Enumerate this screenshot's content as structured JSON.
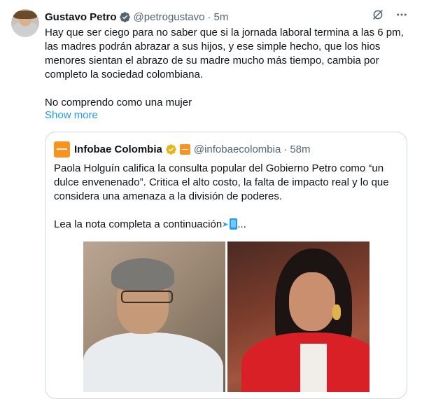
{
  "tweet": {
    "author_name": "Gustavo Petro",
    "handle": "@petrogustavo",
    "separator": "·",
    "time": "5m",
    "body_paragraph_1": "Hay que ser ciego para no saber que si la jornada laboral termina a las 6 pm, las madres podrán abrazar a sus hijos, y ese simple hecho, que los hios menores sientan el abrazo de su madre mucho más tiempo, cambia por completo la sociedad colombiana.",
    "body_paragraph_2": "No comprendo como una mujer",
    "show_more": "Show more"
  },
  "icons": {
    "verified": "verified-badge-icon",
    "grok": "grok-icon",
    "more": "more-options-icon",
    "gold_verified": "gold-verified-badge-icon",
    "org_affiliation": "org-affiliation-badge-icon",
    "phone_emoji": "mobile-phone-with-arrow-emoji"
  },
  "quote": {
    "author_name": "Infobae Colombia",
    "handle": "@infobaecolombia",
    "separator": "·",
    "time": "58m",
    "body_paragraph_1": "Paola Holguín califica la consulta popular del Gobierno Petro como “un dulce envenenado”. Critica el alto costo, la falta de impacto real y lo que considera una amenaza a la división de poderes.",
    "body_paragraph_2_prefix": "Lea la nota completa a continuación",
    "body_paragraph_2_suffix": "..."
  },
  "colors": {
    "link_blue": "#1d9bf0",
    "secondary_text": "#536471",
    "border": "#cfd9de",
    "gold_badge": "#e2b719",
    "infobae_orange": "#f7931e"
  }
}
